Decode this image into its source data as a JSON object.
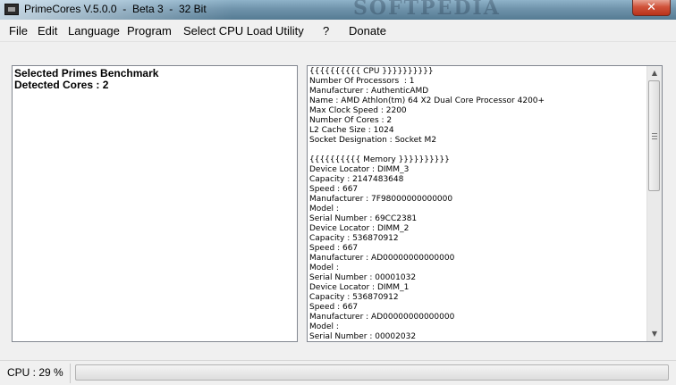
{
  "window": {
    "title": "PrimeCores V.5.0.0  -  Beta 3  -  32 Bit",
    "close_glyph": "✕",
    "watermark": "SOFTPEDIA",
    "app_icon": "app-icon"
  },
  "menu": {
    "items": [
      "File",
      "Edit",
      "Language",
      "Program",
      "Select CPU Load",
      "Utility",
      "?",
      "Donate"
    ]
  },
  "left_panel": {
    "lines": [
      "Selected Primes Benchmark",
      "Detected Cores : 2"
    ]
  },
  "right_panel": {
    "lines": [
      "{{{{{{{{{{ CPU }}}}}}}}}}",
      "Number Of Processors  : 1",
      "Manufacturer : AuthenticAMD",
      "Name : AMD Athlon(tm) 64 X2 Dual Core Processor 4200+",
      "Max Clock Speed : 2200",
      "Number Of Cores : 2",
      "L2 Cache Size : 1024",
      "Socket Designation : Socket M2",
      "",
      "{{{{{{{{{{ Memory }}}}}}}}}}",
      "Device Locator : DIMM_3",
      "Capacity : 2147483648",
      "Speed : 667",
      "Manufacturer : 7F98000000000000",
      "Model :",
      "Serial Number : 69CC2381",
      "Device Locator : DIMM_2",
      "Capacity : 536870912",
      "Speed : 667",
      "Manufacturer : AD00000000000000",
      "Model :",
      "Serial Number : 00001032",
      "Device Locator : DIMM_1",
      "Capacity : 536870912",
      "Speed : 667",
      "Manufacturer : AD00000000000000",
      "Model :",
      "Serial Number : 00002032"
    ],
    "scroll_up_glyph": "▲",
    "scroll_down_glyph": "▼"
  },
  "status": {
    "cpu_text": "CPU : 29 %",
    "progress_fraction": 0
  },
  "colors": {
    "close_button": "#c8452c",
    "progress_fill": "#06b025"
  }
}
